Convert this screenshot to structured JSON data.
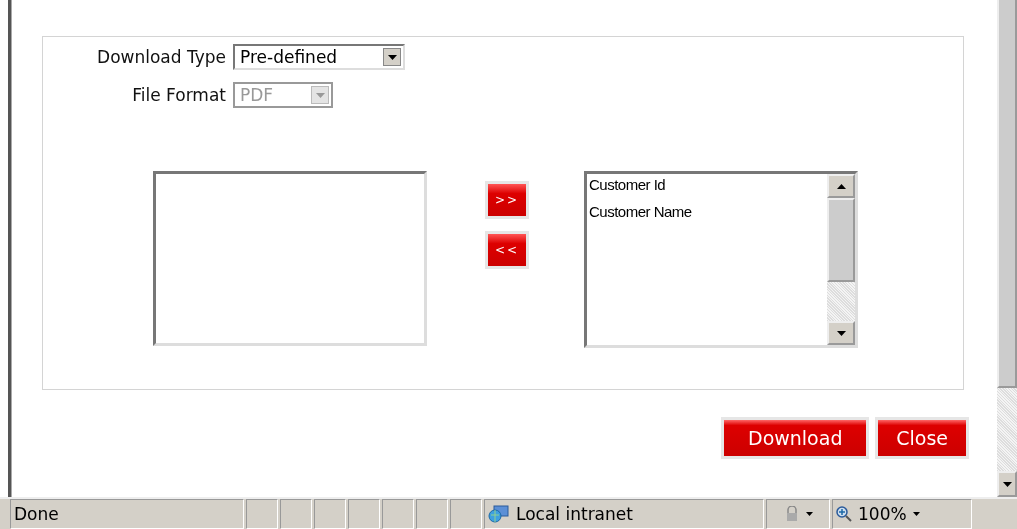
{
  "form": [
    {
      "label": "Download Type",
      "value": "Pre-defined",
      "disabled": false
    },
    {
      "label": "File Format",
      "value": "PDF",
      "disabled": true
    }
  ],
  "move_buttons": [
    ">>",
    "<<"
  ],
  "selected_list": {
    "items": [
      "Customer Id",
      "Customer Name"
    ]
  },
  "buttons": [
    "Download",
    "Close"
  ],
  "status_bar": {
    "status": "Done",
    "zone": "Local intranet",
    "zoom": "100%"
  }
}
